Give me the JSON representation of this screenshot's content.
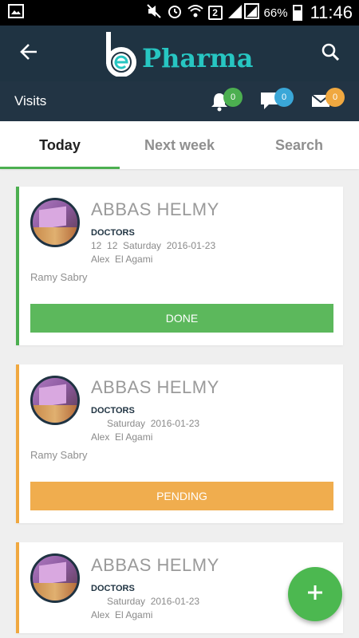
{
  "status_bar": {
    "battery": "66%",
    "time": "11:46",
    "sim_badge": "2",
    "icons": [
      "image-icon",
      "mute-icon",
      "alarm-icon",
      "wifi-icon",
      "signal-icon",
      "battery-icon"
    ]
  },
  "app_bar": {
    "brand_text": "Pharma",
    "brand_color": "#27c6c2",
    "background": "#1f3342"
  },
  "sub_bar": {
    "title": "Visits",
    "notifications": [
      {
        "name": "bell",
        "count": "0",
        "color": "#4caf50"
      },
      {
        "name": "chat",
        "count": "0",
        "color": "#3aa7d8"
      },
      {
        "name": "mail",
        "count": "0",
        "color": "#f0a840"
      }
    ]
  },
  "tabs": [
    {
      "label": "Today",
      "active": true
    },
    {
      "label": "Next week",
      "active": false
    },
    {
      "label": "Search",
      "active": false
    }
  ],
  "visits": [
    {
      "name": "ABBAS HELMY",
      "role": "DOCTORS",
      "date_line": "12  12  Saturday  2016-01-23",
      "area": "Alex  El Agami",
      "rep": "Ramy Sabry",
      "status": "DONE",
      "status_color": "#5cb85c"
    },
    {
      "name": "ABBAS HELMY",
      "role": "DOCTORS",
      "date_line": "      Saturday  2016-01-23",
      "area": "Alex  El Agami",
      "rep": "Ramy Sabry",
      "status": "PENDING",
      "status_color": "#f0ad4e"
    },
    {
      "name": "ABBAS HELMY",
      "role": "DOCTORS",
      "date_line": "      Saturday  2016-01-23",
      "area": "Alex  El Agami",
      "rep": "",
      "status": "",
      "status_color": "#f0ad4e"
    }
  ],
  "fab": {
    "icon": "plus-icon",
    "color": "#4cb850"
  }
}
